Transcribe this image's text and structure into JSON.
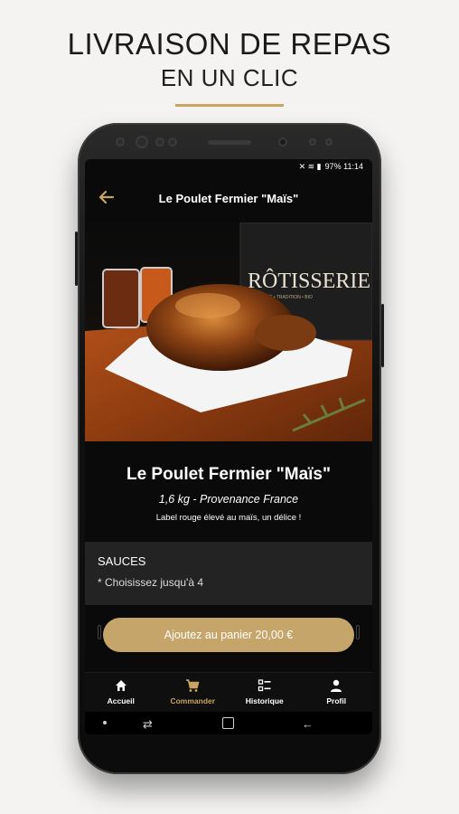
{
  "promo": {
    "headline": "LIVRAISON DE REPAS",
    "subheadline": "EN UN CLIC",
    "accent_color": "#c8a560"
  },
  "status_bar": {
    "text": "97% 11:14"
  },
  "app_bar": {
    "back_icon": "back-arrow-icon",
    "title": "Le Poulet Fermier \"Maïs\""
  },
  "hero": {
    "brand_sign": "RÔTISSERIE",
    "brand_tagline": "QUALITÉ • TRADITION • BIO"
  },
  "product": {
    "title": "Le Poulet Fermier \"Maïs\"",
    "weight_origin": "1,6 kg - Provenance France",
    "description": "Label rouge élevé au maïs, un délice !"
  },
  "sauces": {
    "title": "SAUCES",
    "hint": "* Choisissez jusqu'à 4"
  },
  "cart": {
    "add_label": "Ajoutez au panier 20,00 €"
  },
  "bottom_nav": {
    "items": [
      {
        "label": "Accueil",
        "icon": "home-icon"
      },
      {
        "label": "Commander",
        "icon": "cart-icon",
        "active": true
      },
      {
        "label": "Historique",
        "icon": "history-list-icon"
      },
      {
        "label": "Profil",
        "icon": "user-icon"
      }
    ]
  }
}
